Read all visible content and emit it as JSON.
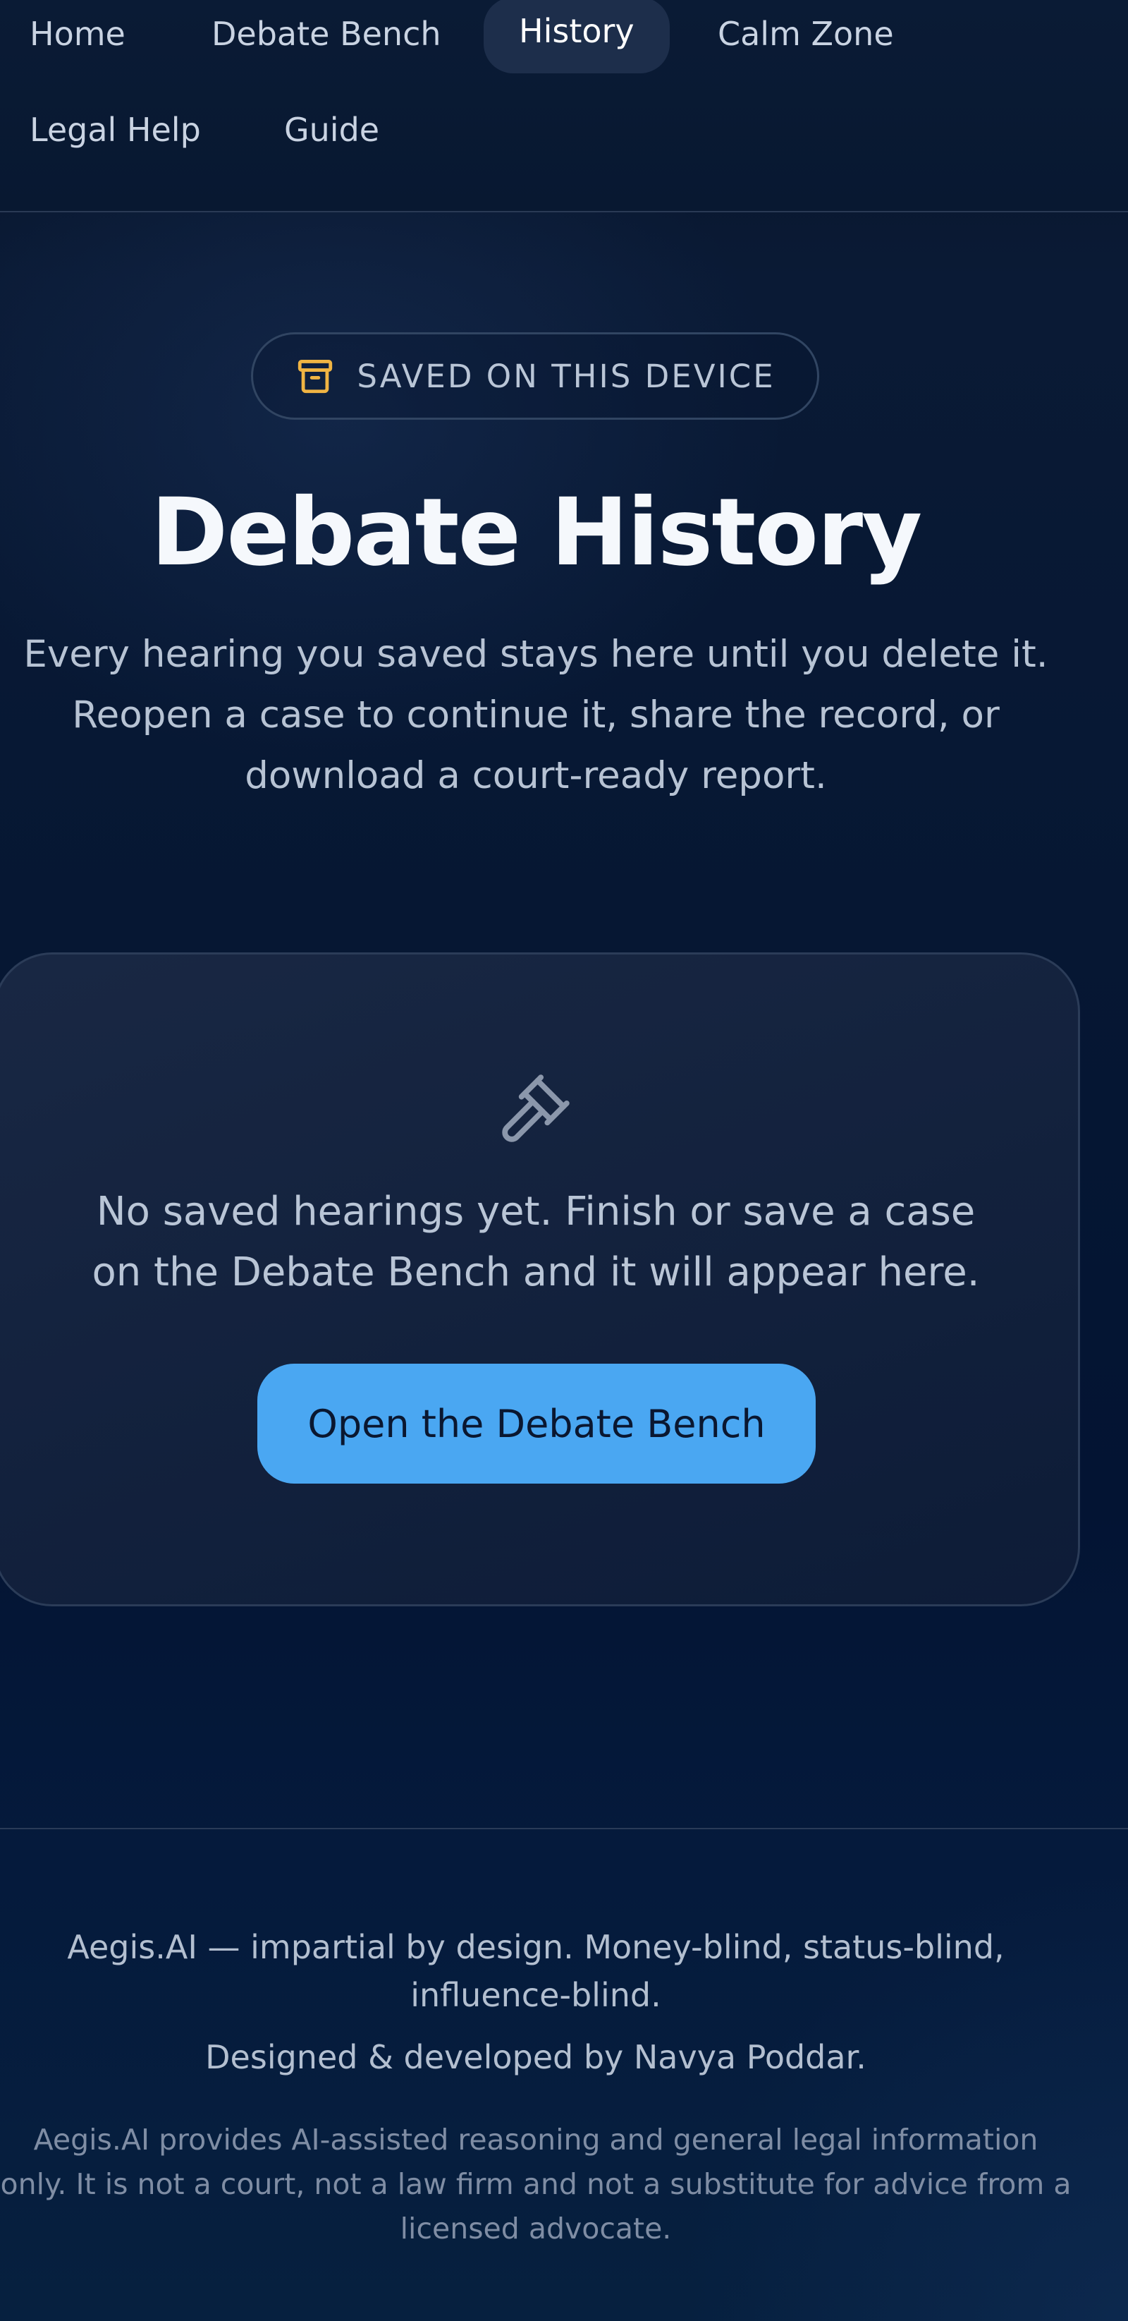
{
  "nav": {
    "items": [
      {
        "label": "Home",
        "active": false
      },
      {
        "label": "Debate Bench",
        "active": false
      },
      {
        "label": "History",
        "active": true
      },
      {
        "label": "Calm Zone",
        "active": false
      },
      {
        "label": "Legal Help",
        "active": false
      },
      {
        "label": "Guide",
        "active": false
      }
    ]
  },
  "hero": {
    "badge_icon": "archive-box-icon",
    "badge_label": "SAVED ON THIS DEVICE",
    "title": "Debate History",
    "description": "Every hearing you saved stays here until you delete it. Reopen a case to continue it, share the record, or download a court-ready report."
  },
  "empty_state": {
    "icon": "gavel-icon",
    "message": "No saved hearings yet. Finish or save a case on the Debate Bench and it will appear here.",
    "button_label": "Open the Debate Bench"
  },
  "footer": {
    "tagline": "Aegis.AI — impartial by design. Money-blind, status-blind, influence-blind.",
    "credit": "Designed & developed by Navya Poddar.",
    "disclaimer": "Aegis.AI provides AI-assisted reasoning and general legal information only. It is not a court, not a law firm and not a substitute for advice from a licensed advocate."
  },
  "colors": {
    "background": "#061733",
    "accent_button": "#4aa7f2",
    "badge_icon": "#f0b443",
    "nav_active_bg": "#1d2e4b"
  }
}
